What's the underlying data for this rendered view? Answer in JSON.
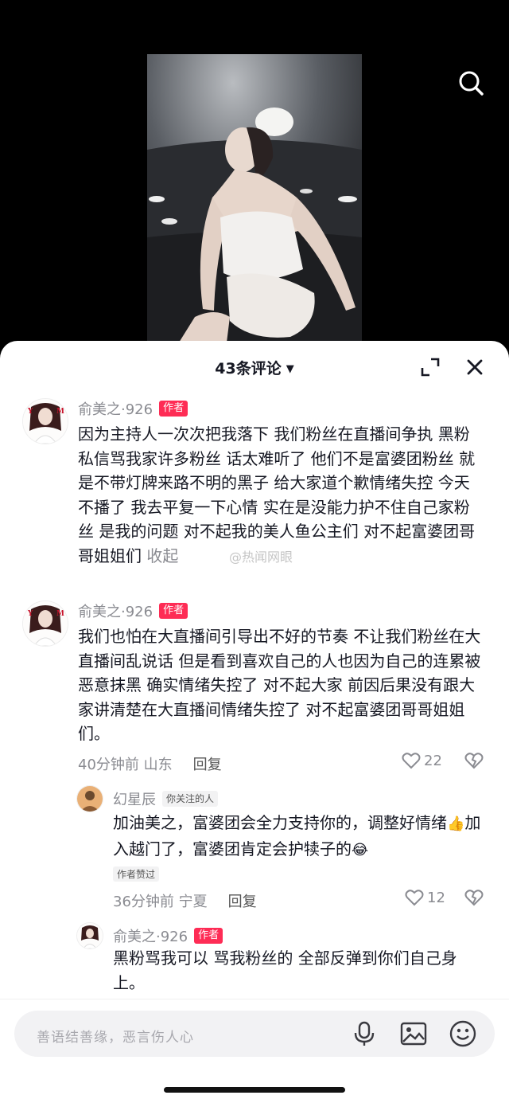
{
  "header": {
    "count_label": "43条评论"
  },
  "comments": [
    {
      "name": "俞美之·926",
      "badge": "作者",
      "text": "因为主持人一次次把我落下 我们粉丝在直播间争执 黑粉私信骂我家许多粉丝 话太难听了 他们不是富婆团粉丝 就是不带灯牌来路不明的黑子 给大家道个歉情绪失控 今天不播了 我去平复一下心情 实在是没能力护不住自己家粉丝 是我的问题 对不起我的美人鱼公主们 对不起富婆团哥哥姐姐们",
      "collapse": "收起"
    },
    {
      "name": "俞美之·926",
      "badge": "作者",
      "text": "我们也怕在大直播间引导出不好的节奏 不让我们粉丝在大直播间乱说话 但是看到喜欢自己的人也因为自己的连累被恶意抹黑 确实情绪失控了 对不起大家 前因后果没有跟大家讲清楚在大直播间情绪失控了 对不起富婆团哥哥姐姐们。",
      "time": "40分钟前 山东",
      "reply": "回复",
      "likes": "22"
    }
  ],
  "replies": [
    {
      "name": "幻星辰",
      "badge": "你关注的人",
      "text_a": "加油美之，富婆团会全力支持你的，调整好情绪",
      "emoji_a": "👍",
      "text_b": "加入越门了，富婆团肯定会护犊子的",
      "emoji_b": "😂",
      "liked_tag": "作者赞过",
      "time": "36分钟前 宁夏",
      "reply": "回复",
      "likes": "12"
    },
    {
      "name": "俞美之·926",
      "badge": "作者",
      "text": "黑粉骂我可以 骂我粉丝的 全部反弹到你们自己身上。"
    }
  ],
  "watermark": "@热闻网眼",
  "input": {
    "placeholder": "善语结善缘，恶言伤人心"
  },
  "colors": {
    "accent": "#fe2c55",
    "text": "#161823",
    "muted": "#8a8b91"
  }
}
